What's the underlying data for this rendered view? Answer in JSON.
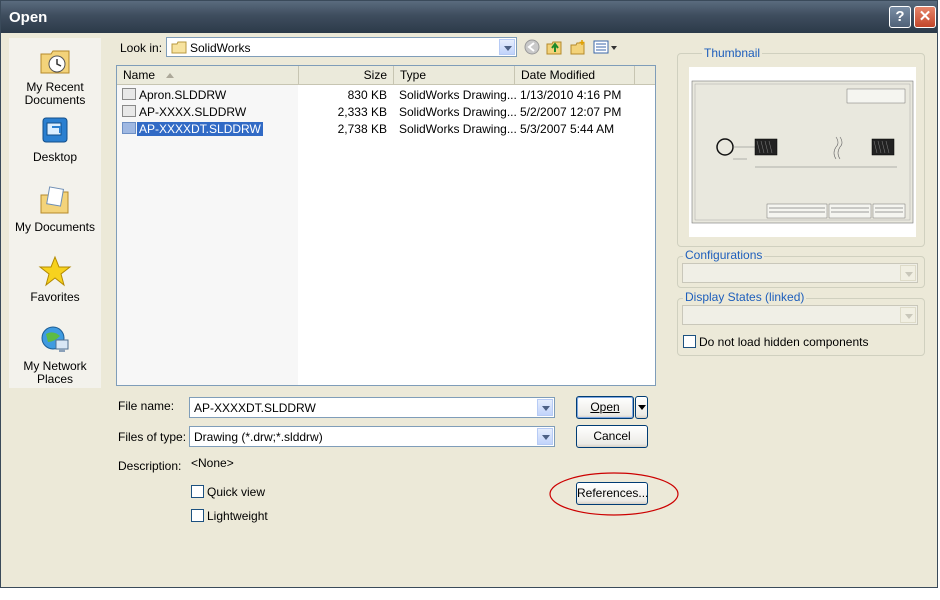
{
  "window": {
    "title": "Open",
    "help_label": "?",
    "close_label": "✕"
  },
  "places": [
    {
      "label": "My Recent Documents",
      "icon": "recent-documents-icon"
    },
    {
      "label": "Desktop",
      "icon": "desktop-icon"
    },
    {
      "label": "My Documents",
      "icon": "my-documents-icon"
    },
    {
      "label": "Favorites",
      "icon": "favorites-icon"
    },
    {
      "label": "My Network Places",
      "icon": "network-places-icon"
    }
  ],
  "lookin": {
    "label": "Look in:",
    "value": "SolidWorks"
  },
  "list": {
    "columns": [
      "Name",
      "Size",
      "Type",
      "Date Modified"
    ],
    "rows": [
      {
        "name": "Apron.SLDDRW",
        "size": "830 KB",
        "type": "SolidWorks Drawing...",
        "date": "1/13/2010 4:16 PM",
        "selected": false
      },
      {
        "name": "AP-XXXX.SLDDRW",
        "size": "2,333 KB",
        "type": "SolidWorks Drawing...",
        "date": "5/2/2007 12:07 PM",
        "selected": false
      },
      {
        "name": "AP-XXXXDT.SLDDRW",
        "size": "2,738 KB",
        "type": "SolidWorks Drawing...",
        "date": "5/3/2007 5:44 AM",
        "selected": true
      }
    ]
  },
  "filename": {
    "label": "File name:",
    "value": "AP-XXXXDT.SLDDRW"
  },
  "filetype": {
    "label": "Files of type:",
    "value": "Drawing (*.drw;*.slddrw)"
  },
  "description": {
    "label": "Description:",
    "value": "<None>"
  },
  "buttons": {
    "open": "Open",
    "cancel": "Cancel",
    "references": "References..."
  },
  "options": {
    "quick_view": "Quick view",
    "lightweight": "Lightweight"
  },
  "right_panel": {
    "thumbnail_label": "Thumbnail",
    "configurations_label": "Configurations",
    "display_states_label": "Display States (linked)",
    "hidden_components_label": "Do not load hidden components"
  },
  "colors": {
    "accent_highlight": "#316ac5",
    "annotation": "#cc0000"
  }
}
